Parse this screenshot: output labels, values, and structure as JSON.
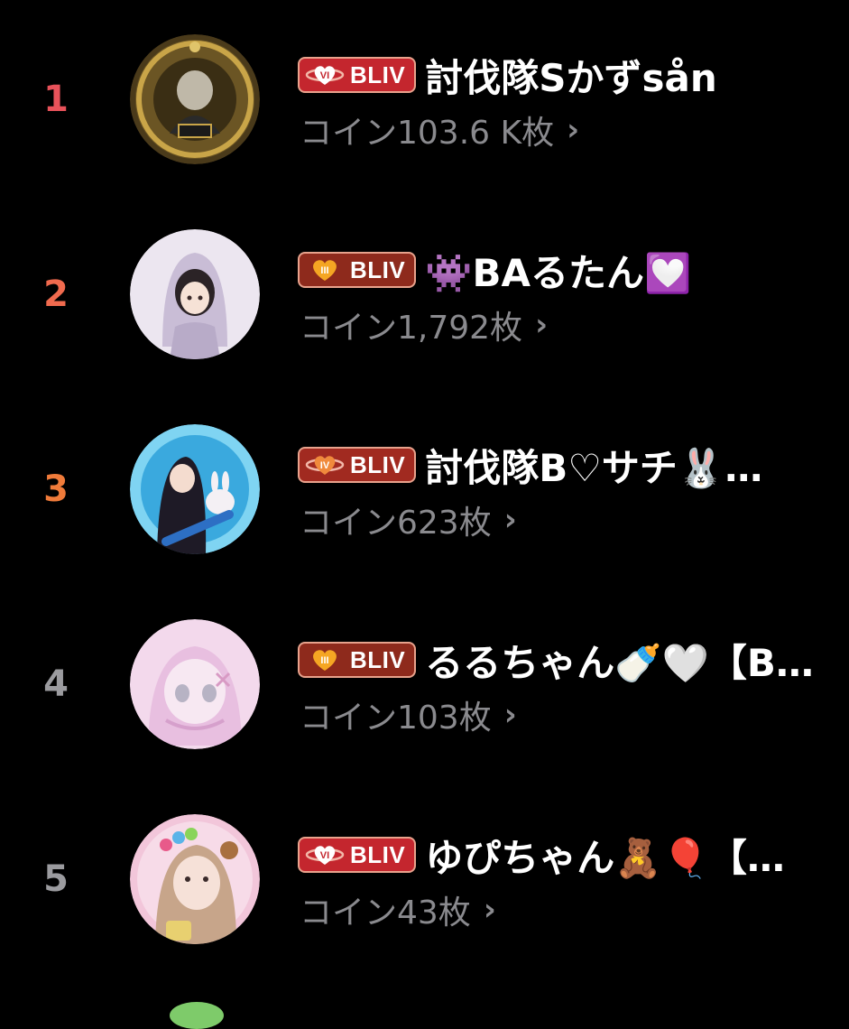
{
  "colors": {
    "background": "#000000",
    "rank1": "#e8525a",
    "rank2": "#f06a4e",
    "rank3": "#f07b3a",
    "rank_other": "#9b9b9f",
    "coin_text": "#8a8a8e",
    "badge_border": "#e8a28c",
    "badge_vi_bg": "#c4262e",
    "badge_iv_bg": "#a12a20",
    "badge_iii_bg": "#8e2a1c"
  },
  "ranking": [
    {
      "rank": "1",
      "badge_level": "VI",
      "badge_label": "BLIV",
      "name": "討伐隊Sかずsån",
      "coins": "コイン103.6 K枚",
      "chevron": "›",
      "avatar_icon": "sponsor-emblem-avatar"
    },
    {
      "rank": "2",
      "badge_level": "III",
      "badge_label": "BLIV",
      "name": "👾BAるたん💟",
      "coins": "コイン1,792枚",
      "chevron": "›",
      "avatar_icon": "hooded-girl-avatar"
    },
    {
      "rank": "3",
      "badge_level": "IV",
      "badge_label": "BLIV",
      "name": "討伐隊B♡サチ🐰…",
      "coins": "コイン623枚",
      "chevron": "›",
      "avatar_icon": "anime-girl-bunny-avatar"
    },
    {
      "rank": "4",
      "badge_level": "III",
      "badge_label": "BLIV",
      "name": "るるちゃん🍼🤍【B…",
      "coins": "コイン103枚",
      "chevron": "›",
      "avatar_icon": "pink-anime-avatar"
    },
    {
      "rank": "5",
      "badge_level": "VI",
      "badge_label": "BLIV",
      "name": "ゆぴちゃん🧸🎈【…",
      "coins": "コイン43枚",
      "chevron": "›",
      "avatar_icon": "photo-girl-avatar"
    }
  ]
}
